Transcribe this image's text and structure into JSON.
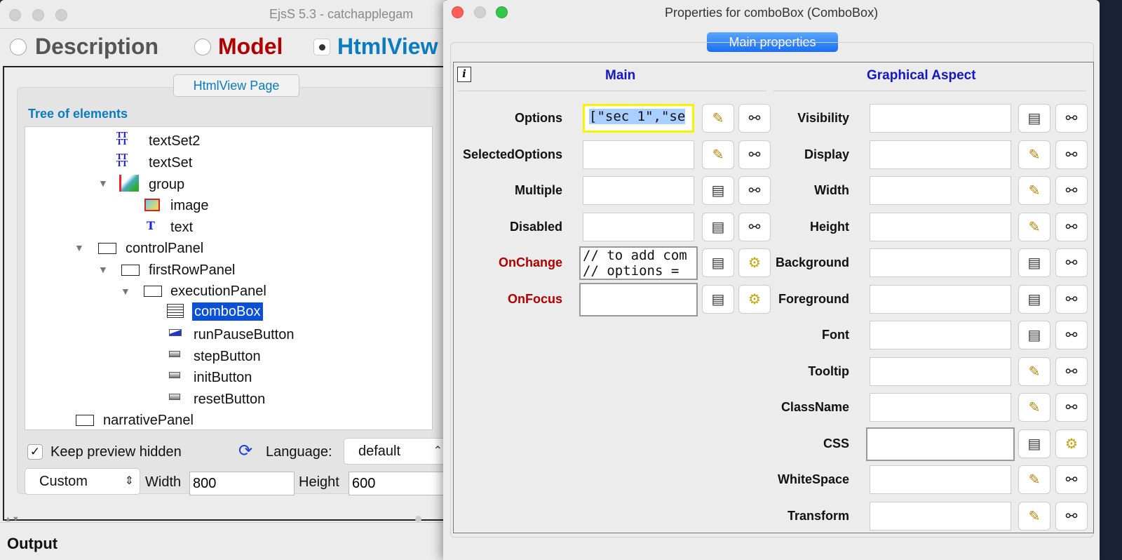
{
  "left_window": {
    "title": "EjsS 5.3 - catchapplegam",
    "tabs": [
      {
        "label": "Description",
        "color": "#555555",
        "selected": false
      },
      {
        "label": "Model",
        "color": "#b00000",
        "selected": false
      },
      {
        "label": "HtmlView",
        "color": "#0a7cc0",
        "selected": true
      }
    ],
    "page_button": "HtmlView Page",
    "tree_title": "Tree of elements",
    "tree": [
      {
        "label": "textSet2",
        "icon": "text-set-icon"
      },
      {
        "label": "textSet",
        "icon": "text-set-icon"
      },
      {
        "label": "group",
        "icon": "group-icon",
        "expanded": true
      },
      {
        "label": "image",
        "icon": "image-icon"
      },
      {
        "label": "text",
        "icon": "text-icon"
      },
      {
        "label": "controlPanel",
        "icon": "panel-icon",
        "expanded": true
      },
      {
        "label": "firstRowPanel",
        "icon": "panel-icon",
        "expanded": true
      },
      {
        "label": "executionPanel",
        "icon": "panel-icon",
        "expanded": true
      },
      {
        "label": "comboBox",
        "icon": "combobox-icon",
        "selected": true
      },
      {
        "label": "runPauseButton",
        "icon": "button-icon"
      },
      {
        "label": "stepButton",
        "icon": "button-icon"
      },
      {
        "label": "initButton",
        "icon": "button-icon"
      },
      {
        "label": "resetButton",
        "icon": "button-icon"
      },
      {
        "label": "narrativePanel",
        "icon": "panel-icon"
      }
    ],
    "keep_preview_label": "Keep preview hidden",
    "keep_preview_checked": true,
    "language_label": "Language:",
    "language_value": "default",
    "size_preset": "Custom",
    "width_label": "Width",
    "width_value": "800",
    "height_label": "Height",
    "height_value": "600",
    "output_label": "Output"
  },
  "right_window": {
    "title": "Properties for comboBox (ComboBox)",
    "main_properties_button": "Main properties",
    "main_header": "Main",
    "graphical_header": "Graphical Aspect",
    "main_props": [
      {
        "label": "Options",
        "value": "[\"sec 1\",\"se",
        "icon1": "edit",
        "icon2": "link",
        "highlight": true
      },
      {
        "label": "SelectedOptions",
        "value": "",
        "icon1": "edit",
        "icon2": "link"
      },
      {
        "label": "Multiple",
        "value": "",
        "icon1": "form",
        "icon2": "link"
      },
      {
        "label": "Disabled",
        "value": "",
        "icon1": "form",
        "icon2": "link"
      },
      {
        "label": "OnChange",
        "value": "// to add com\n// options =",
        "icon1": "form",
        "icon2": "gear",
        "red": true
      },
      {
        "label": "OnFocus",
        "value": "",
        "icon1": "form",
        "icon2": "gear",
        "red": true
      }
    ],
    "graphical_props": [
      {
        "label": "Visibility",
        "icon1": "form",
        "icon2": "link"
      },
      {
        "label": "Display",
        "icon1": "edit",
        "icon2": "link"
      },
      {
        "label": "Width",
        "icon1": "edit",
        "icon2": "link"
      },
      {
        "label": "Height",
        "icon1": "edit",
        "icon2": "link"
      },
      {
        "label": "Background",
        "icon1": "form",
        "icon2": "link"
      },
      {
        "label": "Foreground",
        "icon1": "form",
        "icon2": "link"
      },
      {
        "label": "Font",
        "icon1": "form",
        "icon2": "link"
      },
      {
        "label": "Tooltip",
        "icon1": "edit",
        "icon2": "link"
      },
      {
        "label": "ClassName",
        "icon1": "edit",
        "icon2": "link"
      },
      {
        "label": "CSS",
        "icon1": "form",
        "icon2": "gear"
      },
      {
        "label": "WhiteSpace",
        "icon1": "edit",
        "icon2": "link"
      },
      {
        "label": "Transform",
        "icon1": "edit",
        "icon2": "link"
      }
    ]
  }
}
